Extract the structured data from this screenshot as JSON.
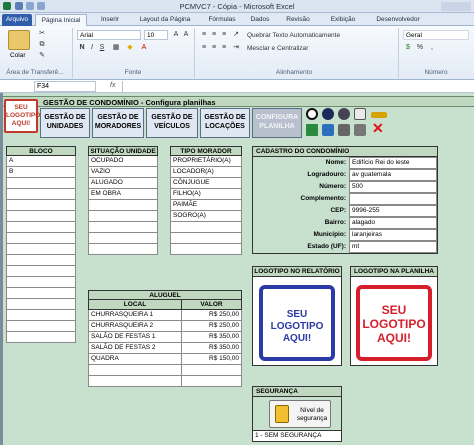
{
  "window": {
    "title": "PCMVC7 - Cópia  -  Microsoft Excel"
  },
  "ribbon_tabs": [
    "Arquivo",
    "Página Inicial",
    "Inserir",
    "Layout da Página",
    "Fórmulas",
    "Dados",
    "Revisão",
    "Exibição",
    "Desenvolvedor"
  ],
  "ribbon": {
    "paste_label": "Colar",
    "font_name": "Arial",
    "font_size": "10",
    "wrap_text": "Quebrar Texto Automaticamente",
    "merge_center": "Mesclar e Centralizar",
    "number_format": "Geral",
    "groups": {
      "clipboard": "Área de Transferê...",
      "font": "Fonte",
      "alignment": "Alinhamento",
      "number": "Número"
    }
  },
  "formula_bar": {
    "name_box": "F34",
    "fx": "fx"
  },
  "app": {
    "title": "GESTÃO DE CONDOMÍNIO  -  Configura planilhas",
    "logo_text": "SEU LOGOTIPO AQUI!",
    "nav_buttons": [
      "GESTÃO DE UNIDADES",
      "GESTÃO DE MORADORES",
      "GESTÃO DE VEÍCULOS",
      "GESTÃO DE LOCAÇÕES",
      "CONFIGURA PLANILHA"
    ]
  },
  "bloco": {
    "title": "BLOCO",
    "rows": [
      "A",
      "B",
      "",
      "",
      "",
      "",
      "",
      "",
      "",
      "",
      "",
      "",
      "",
      "",
      "",
      "",
      ""
    ]
  },
  "situacao": {
    "title": "SITUAÇÃO UNIDADE",
    "rows": [
      "OCUPADO",
      "VAZIO",
      "ALUGADO",
      "EM OBRA",
      "",
      "",
      "",
      "",
      ""
    ]
  },
  "tipo_morador": {
    "title": "TIPO MORADOR",
    "rows": [
      "PROPRIETÁRIO(A)",
      "LOCADOR(A)",
      "CÔNJUGUE",
      "FILHO(A)",
      "PAIMÃE",
      "SOGRO(A)",
      "",
      "",
      ""
    ]
  },
  "cadastro": {
    "title": "CADASTRO DO CONDOMÍNIO",
    "fields": [
      {
        "label": "Nome:",
        "value": "Edifício Rei do leste"
      },
      {
        "label": "Logradouro:",
        "value": "av guatemala"
      },
      {
        "label": "Número:",
        "value": "500"
      },
      {
        "label": "Complemento:",
        "value": ""
      },
      {
        "label": "CEP:",
        "value": "9996-255"
      },
      {
        "label": "Bairro:",
        "value": "alagado"
      },
      {
        "label": "Município:",
        "value": "laranjeiras"
      },
      {
        "label": "Estado (UF):",
        "value": "mt"
      }
    ]
  },
  "aluguel": {
    "title": "ALUGUEL",
    "col_local": "LOCAL",
    "col_valor": "VALOR",
    "rows": [
      {
        "local": "CHURRASQUEIRA 1",
        "valor": "R$ 250,00"
      },
      {
        "local": "CHURRASQUEIRA 2",
        "valor": "R$ 250,00"
      },
      {
        "local": "SALÃO DE FESTAS 1",
        "valor": "R$ 350,00"
      },
      {
        "local": "SALÃO DE FESTAS 2",
        "valor": "R$ 350,00"
      },
      {
        "local": "QUADRA",
        "valor": "R$ 150,00"
      },
      {
        "local": "",
        "valor": ""
      },
      {
        "local": "",
        "valor": ""
      }
    ]
  },
  "logo_relatorio": {
    "title": "LOGOTIPO NO RELATÓRIO",
    "text": "SEU LOGOTIPO AQUI!"
  },
  "logo_planilha": {
    "title": "LOGOTIPO NA PLANILHA",
    "text": "SEU LOGOTIPO AQUI!"
  },
  "seguranca": {
    "title": "SEGURANÇA",
    "button": "Nível de segurança",
    "status": "1 - SEM SEGURANÇA"
  },
  "colors": {
    "excel_blue": "#2f5fa8",
    "sheet_green": "#c8e0ce",
    "logo_red": "#d61f2a",
    "logo_blue": "#2b3aa6"
  }
}
